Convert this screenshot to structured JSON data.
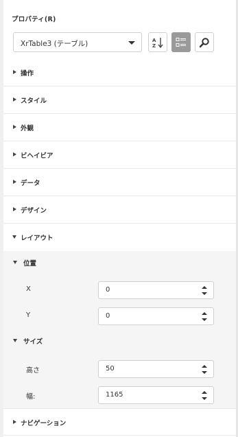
{
  "panel": {
    "title": "プロパティ(R)"
  },
  "object_selector": {
    "value": "XrTable3 (テーブル)",
    "icon": "chevron-down-icon"
  },
  "toolbar": {
    "sort_icon": "sort-alpha-icon",
    "categorized_icon": "categorized-view-icon",
    "search_icon": "search-icon",
    "active_color": "#9a9a9a"
  },
  "sections": [
    {
      "label": "操作",
      "expanded": false
    },
    {
      "label": "スタイル",
      "expanded": false
    },
    {
      "label": "外観",
      "expanded": false
    },
    {
      "label": "ビヘイビア",
      "expanded": false
    },
    {
      "label": "データ",
      "expanded": false
    },
    {
      "label": "デザイン",
      "expanded": false
    },
    {
      "label": "レイアウト",
      "expanded": true
    },
    {
      "label": "ナビゲーション",
      "expanded": false
    }
  ],
  "layout": {
    "position": {
      "label": "位置",
      "x_label": "X",
      "x_value": "0",
      "y_label": "Y",
      "y_value": "0"
    },
    "size": {
      "label": "サイズ",
      "height_label": "高さ",
      "height_value": "50",
      "width_label": "幅:",
      "width_value": "1165"
    }
  }
}
